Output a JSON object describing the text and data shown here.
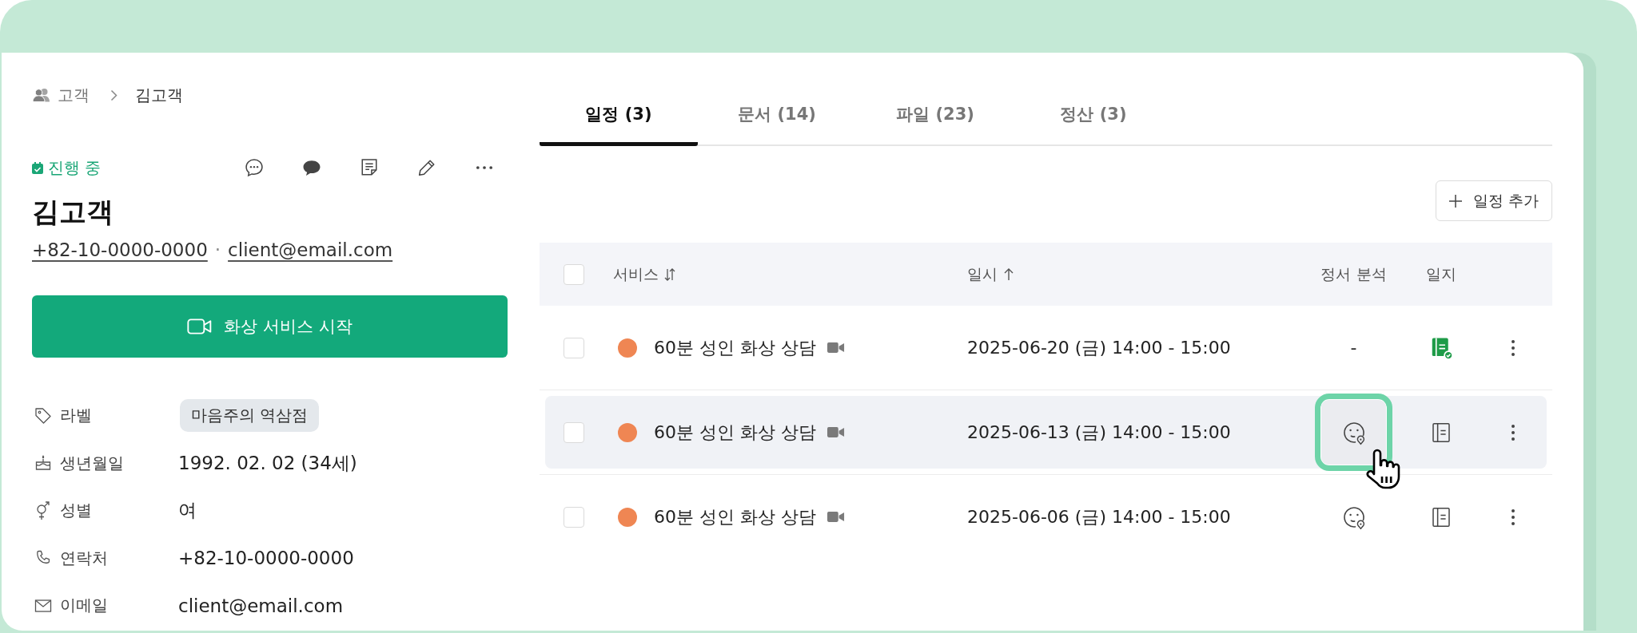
{
  "breadcrumb": [
    {
      "label": "고객"
    },
    {
      "label": "김고객"
    }
  ],
  "client": {
    "status": "진행 중",
    "name": "김고객",
    "phone": "+82-10-0000-0000",
    "separator": "·",
    "email": "client@email.com"
  },
  "start_button": {
    "label": "화상 서비스 시작"
  },
  "details": [
    {
      "kind": "tag",
      "label": "라벨",
      "value": "마음주의 역삼점"
    },
    {
      "kind": "text",
      "label": "생년월일",
      "value": "1992. 02. 02 (34세)"
    },
    {
      "kind": "text",
      "label": "성별",
      "value": "여"
    },
    {
      "kind": "text",
      "label": "연락처",
      "value": "+82-10-0000-0000"
    },
    {
      "kind": "text",
      "label": "이메일",
      "value": "client@email.com"
    }
  ],
  "tabs": [
    {
      "label": "일정 (3)",
      "selected": true
    },
    {
      "label": "문서 (14)",
      "selected": false
    },
    {
      "label": "파일 (23)",
      "selected": false
    },
    {
      "label": "정산 (3)",
      "selected": false
    }
  ],
  "add_button": {
    "label": "일정 추가"
  },
  "table": {
    "select_all": {
      "checked": false
    },
    "columns": [
      {
        "label": "서비스",
        "kind": "sortable"
      },
      {
        "label": "일시",
        "kind": "ascending"
      },
      {
        "label": "정서 분석",
        "kind": "plain"
      },
      {
        "label": "일지",
        "kind": "plain"
      }
    ],
    "rows": [
      {
        "checked": false,
        "hovered": false,
        "color": "#ef8653",
        "service": "60분 성인 화상 상담",
        "video": true,
        "datetime": "2025-06-20 (금) 14:00 - 15:00",
        "analysis": {
          "kind": "empty",
          "text": "-"
        },
        "journal": {
          "kind": "written"
        }
      },
      {
        "checked": false,
        "hovered": true,
        "color": "#ef8653",
        "service": "60분 성인 화상 상담",
        "video": true,
        "datetime": "2025-06-13 (금) 14:00 - 15:00",
        "analysis": {
          "kind": "available",
          "highlighted": true
        },
        "journal": {
          "kind": "blank"
        }
      },
      {
        "checked": false,
        "hovered": false,
        "color": "#ef8653",
        "service": "60분 성인 화상 상담",
        "video": true,
        "datetime": "2025-06-06 (금) 14:00 - 15:00",
        "analysis": {
          "kind": "available",
          "highlighted": false
        },
        "journal": {
          "kind": "blank"
        }
      }
    ]
  }
}
